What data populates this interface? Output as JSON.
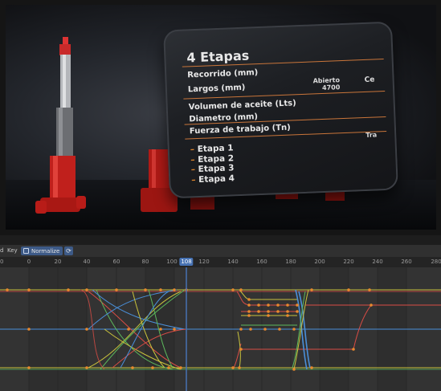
{
  "viewport": {
    "card": {
      "title": "4 Etapas",
      "rows": [
        "Recorrido (mm)",
        "Largos (mm)",
        "Volumen de aceite (Lts)",
        "Diametro (mm)",
        "Fuerza de trabajo (Tn)"
      ],
      "open_label": "Abierto",
      "open_value": "4700",
      "cut_right_1": "Ce",
      "cut_right_2": "Tra",
      "stages": [
        "Etapa 1",
        "Etapa 2",
        "Etapa 3",
        "Etapa 4"
      ]
    }
  },
  "editor": {
    "header": {
      "left_cut": "d",
      "key_menu": "Key",
      "normalize_label": "Normalize",
      "refresh_icon": "refresh-icon"
    },
    "ruler": {
      "ticks": [
        "20",
        "0",
        "20",
        "40",
        "60",
        "80",
        "100",
        "120",
        "140",
        "160",
        "180",
        "200",
        "220",
        "240",
        "260",
        "280"
      ],
      "current_frame": "108"
    },
    "colors": {
      "red": "#d94c45",
      "yellow": "#c9c23c",
      "green": "#5cb85c",
      "blue": "#4a8fd9",
      "accent": "#4772b3",
      "key_orange": "#e8892d"
    }
  }
}
